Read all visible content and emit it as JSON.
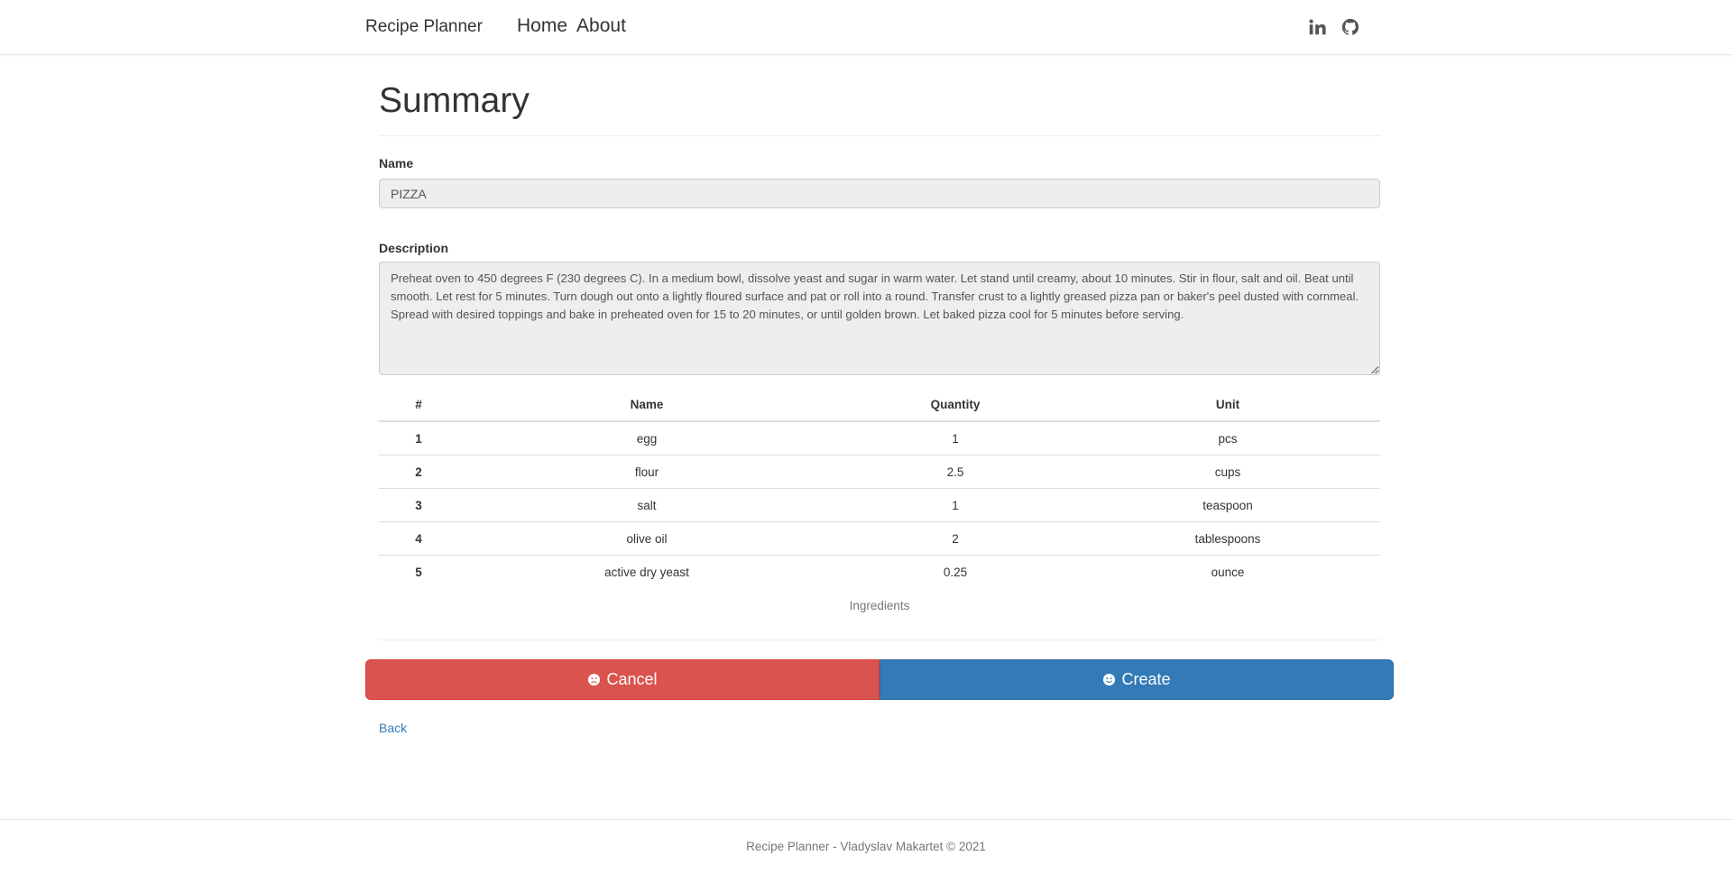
{
  "navbar": {
    "brand": "Recipe Planner",
    "links": [
      "Home",
      "About"
    ],
    "social_icons": [
      "linkedin-icon",
      "github-icon"
    ]
  },
  "page": {
    "title": "Summary"
  },
  "form": {
    "name_label": "Name",
    "name_value": "PIZZA",
    "description_label": "Description",
    "description_value": "Preheat oven to 450 degrees F (230 degrees C). In a medium bowl, dissolve yeast and sugar in warm water. Let stand until creamy, about 10 minutes. Stir in flour, salt and oil. Beat until smooth. Let rest for 5 minutes. Turn dough out onto a lightly floured surface and pat or roll into a round. Transfer crust to a lightly greased pizza pan or baker's peel dusted with cornmeal. Spread with desired toppings and bake in preheated oven for 15 to 20 minutes, or until golden brown. Let baked pizza cool for 5 minutes before serving."
  },
  "ingredients": {
    "columns": [
      "#",
      "Name",
      "Quantity",
      "Unit"
    ],
    "rows": [
      [
        "1",
        "egg",
        "1",
        "pcs"
      ],
      [
        "2",
        "flour",
        "2.5",
        "cups"
      ],
      [
        "3",
        "salt",
        "1",
        "teaspoon"
      ],
      [
        "4",
        "olive oil",
        "2",
        "tablespoons"
      ],
      [
        "5",
        "active dry yeast",
        "0.25",
        "ounce"
      ]
    ],
    "caption": "Ingredients"
  },
  "actions": {
    "cancel_label": "Cancel",
    "cancel_icon": "frown-icon",
    "create_label": "Create",
    "create_icon": "smile-icon",
    "back_label": "Back"
  },
  "colors": {
    "cancel": "#d9534f",
    "create": "#337ab7",
    "link": "#337ab7"
  },
  "footer": {
    "text": "Recipe Planner - Vladyslav Makartet © 2021"
  }
}
